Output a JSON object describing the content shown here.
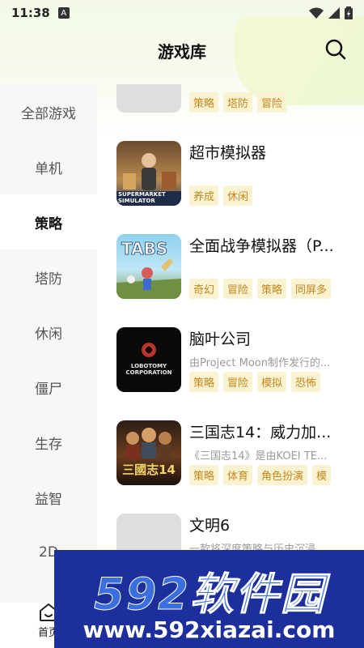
{
  "status_bar": {
    "time": "11:38",
    "notif": "A"
  },
  "header": {
    "title": "游戏库"
  },
  "sidebar": {
    "items": [
      {
        "label": "全部游戏",
        "active": false
      },
      {
        "label": "单机",
        "active": false
      },
      {
        "label": "策略",
        "active": true
      },
      {
        "label": "塔防",
        "active": false
      },
      {
        "label": "休闲",
        "active": false
      },
      {
        "label": "僵尸",
        "active": false
      },
      {
        "label": "生存",
        "active": false
      },
      {
        "label": "益智",
        "active": false
      },
      {
        "label": "2D",
        "active": false
      }
    ]
  },
  "games": [
    {
      "title": "",
      "desc": "",
      "tags": [
        "策略",
        "塔防",
        "冒险"
      ]
    },
    {
      "title": "超市模拟器",
      "desc": "",
      "tags": [
        "养成",
        "休闲"
      ],
      "thumb_text": "SUPERMARKET SIMULATOR"
    },
    {
      "title": "全面战争模拟器（P...",
      "desc": "",
      "tags": [
        "奇幻",
        "冒险",
        "策略",
        "同屏多"
      ],
      "thumb_text": "TABS"
    },
    {
      "title": "脑叶公司",
      "desc": "由Project Moon制作发行的...",
      "tags": [
        "策略",
        "冒险",
        "模拟",
        "恐怖"
      ],
      "thumb_text": "LOBOTOMY CORPORATION"
    },
    {
      "title": "三国志14：威力加...",
      "desc": "《三国志14》是由KOEI TE...",
      "tags": [
        "策略",
        "体育",
        "角色扮演",
        "模"
      ],
      "thumb_text": "三國志14"
    },
    {
      "title": "文明6",
      "desc": "一款将深度策略与历史沉浸...",
      "tags": []
    }
  ],
  "bottom_nav": {
    "home_label": "首页"
  },
  "watermark": {
    "line1": "592软件园",
    "line2": "www.592xiazai.com"
  },
  "colors": {
    "tag_bg": "#fbf2d2",
    "tag_text": "#c1881f",
    "sidebar_bg": "#f6f7f8",
    "watermark_bg": "#1c2f9c"
  }
}
